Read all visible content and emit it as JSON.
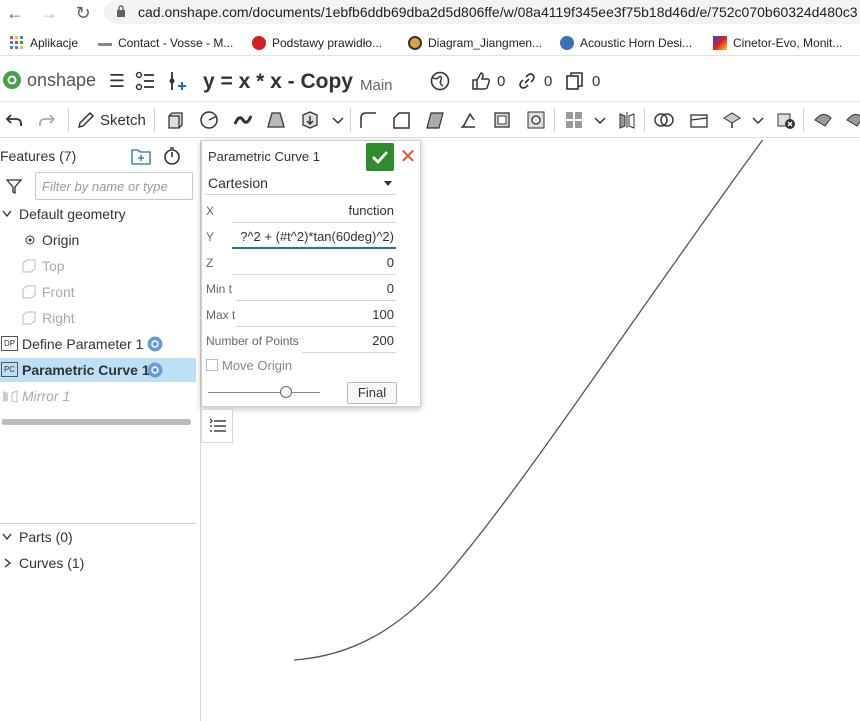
{
  "browser": {
    "url": "cad.onshape.com/documents/1ebfb6ddb69dba2d5d806ffe/w/08a4119f345ee3f75b18d46d/e/752c070b60324d480c3"
  },
  "bookmarks": [
    {
      "label": "Aplikacje",
      "icon": "apps-grid-icon"
    },
    {
      "label": "Contact - Vosse - M...",
      "icon": "vosse-icon"
    },
    {
      "label": "Podstawy prawidło...",
      "icon": "pdf-icon"
    },
    {
      "label": "Diagram_Jiangmen...",
      "icon": "shield-icon"
    },
    {
      "label": "Acoustic Horn Desi...",
      "icon": "globe-icon"
    },
    {
      "label": "Cinetor-Evo, Monit...",
      "icon": "heatmap-icon"
    }
  ],
  "header": {
    "logo_text": "onshape",
    "doc_title": "y = x * x - Copy",
    "branch": "Main",
    "likes": "0",
    "links": "0",
    "copies": "0"
  },
  "toolbar": {
    "sketch_label": "Sketch"
  },
  "features": {
    "title": "Features (7)",
    "filter_placeholder": "Filter by name or type",
    "default_geometry": "Default geometry",
    "origin": "Origin",
    "top": "Top",
    "front": "Front",
    "right": "Right",
    "define_param": "Define Parameter 1",
    "define_param_badge": "DP",
    "param_curve": "Parametric Curve 1",
    "param_curve_badge": "PC",
    "mirror": "Mirror 1",
    "parts": "Parts (0)",
    "curves": "Curves (1)"
  },
  "dialog": {
    "title": "Parametric Curve 1",
    "mode": "Cartesion",
    "x_label": "X",
    "x_value": "function",
    "y_label": "Y",
    "y_value": "?^2 + (#t^2)*tan(60deg)^2)",
    "z_label": "Z",
    "z_value": "0",
    "min_t_label": "Min t",
    "min_t_value": "0",
    "max_t_label": "Max t",
    "max_t_value": "100",
    "points_label": "Number of Points",
    "points_value": "200",
    "move_origin_label": "Move Origin",
    "final_label": "Final",
    "slider_level": 0.7
  },
  "colors": {
    "accent": "#1f6fb3",
    "ok_green": "#2e8b2e",
    "cancel_red": "#e0502a",
    "selected_row": "#bde0f5"
  }
}
